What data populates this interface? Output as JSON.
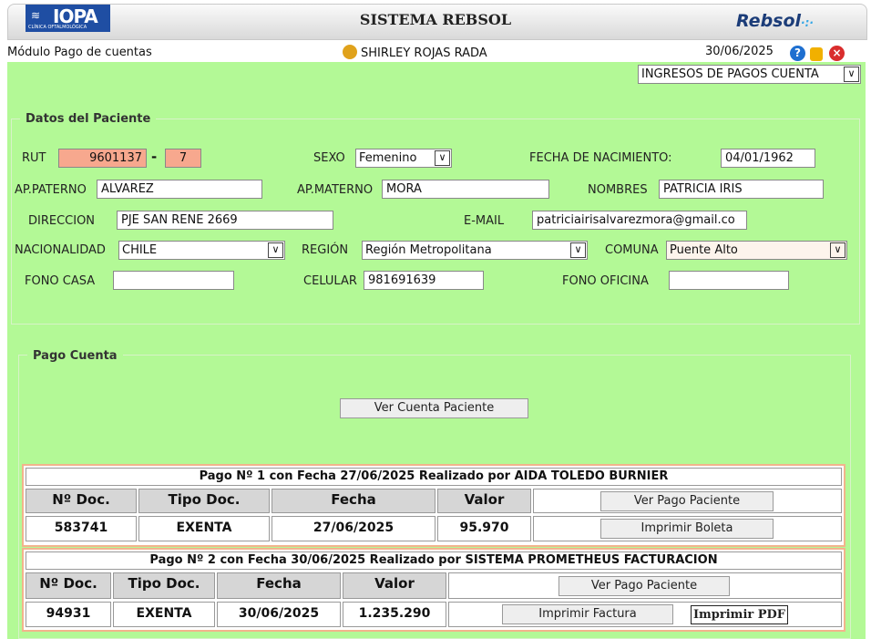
{
  "header": {
    "logo_text": "IOPA",
    "logo_subtitle": "CLÍNICA OFTALMOLÓGICA",
    "title": "SISTEMA REBSOL",
    "brand": "Rebsol"
  },
  "subbar": {
    "module": "Módulo Pago de cuentas",
    "user": "SHIRLEY ROJAS RADA",
    "date": "30/06/2025"
  },
  "menu_select": {
    "value": "INGRESOS DE PAGOS CUENTA"
  },
  "patient": {
    "legend": "Datos del Paciente",
    "rut_label": "RUT",
    "rut": "9601137",
    "rut_sep": "-",
    "rut_dv": "7",
    "sexo_label": "SEXO",
    "sexo": "Femenino",
    "fecha_nac_label": "FECHA DE NACIMIENTO:",
    "fecha_nac": "04/01/1962",
    "ap_paterno_label": "AP.PATERNO",
    "ap_paterno": "ALVAREZ",
    "ap_materno_label": "AP.MATERNO",
    "ap_materno": "MORA",
    "nombres_label": "NOMBRES",
    "nombres": "PATRICIA IRIS",
    "direccion_label": "DIRECCION",
    "direccion": "PJE SAN RENE 2669",
    "email_label": "E-MAIL",
    "email": "patriciairisalvarezmora@gmail.co",
    "nacionalidad_label": "NACIONALIDAD",
    "nacionalidad": "CHILE",
    "region_label": "REGIÓN",
    "region": "Región Metropolitana",
    "comuna_label": "COMUNA",
    "comuna": "Puente Alto",
    "fono_casa_label": "FONO CASA",
    "fono_casa": "",
    "celular_label": "CELULAR",
    "celular": "981691639",
    "fono_oficina_label": "FONO OFICINA",
    "fono_oficina": ""
  },
  "pago_cuenta": {
    "legend": "Pago Cuenta",
    "ver_cuenta_label": "Ver Cuenta Paciente",
    "headers": [
      "Nº Doc.",
      "Tipo Doc.",
      "Fecha",
      "Valor"
    ],
    "payments": [
      {
        "caption": "Pago Nº 1 con Fecha 27/06/2025 Realizado por AIDA TOLEDO BURNIER",
        "doc": "583741",
        "tipo": "EXENTA",
        "fecha": "27/06/2025",
        "valor": "95.970",
        "ver_pago_label": "Ver Pago Paciente",
        "imprimir_label": "Imprimir Boleta"
      },
      {
        "caption": "Pago Nº 2 con Fecha 30/06/2025 Realizado por SISTEMA PROMETHEUS FACTURACION",
        "doc": "94931",
        "tipo": "EXENTA",
        "fecha": "30/06/2025",
        "valor": "1.235.290",
        "ver_pago_label": "Ver Pago Paciente",
        "imprimir_label": "Imprimir Factura",
        "imprimir_pdf_label": "Imprimir PDF"
      }
    ]
  },
  "colors": {
    "background": "#b3f996",
    "rut_field": "#f7a88e",
    "table_border": "#f2b48c",
    "header_cell": "#d6d6d6"
  }
}
